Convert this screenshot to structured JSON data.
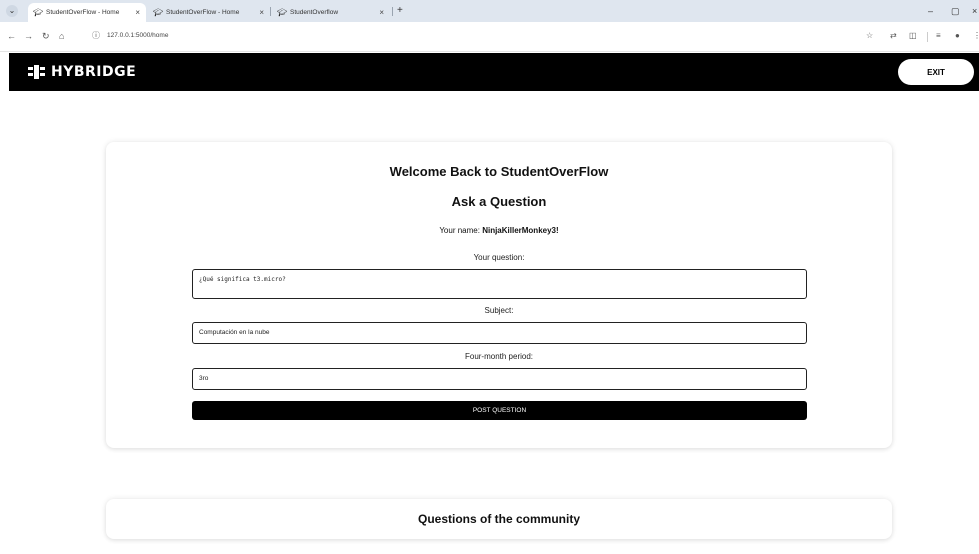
{
  "browser": {
    "tabs": [
      {
        "title": "StudentOverFlow - Home",
        "active": true
      },
      {
        "title": "StudentOverFlow - Home",
        "active": false
      },
      {
        "title": "StudentOverflow",
        "active": false
      }
    ],
    "new_tab": "+",
    "url": "127.0.0.1:5000/home",
    "tab_close": "×",
    "window_controls": {
      "minimize": "–",
      "maximize": "▢",
      "close": "×"
    }
  },
  "header": {
    "logo_text": "HYBRIDGE",
    "exit_label": "EXIT"
  },
  "form": {
    "welcome_title": "Welcome Back to StudentOverFlow",
    "ask_title": "Ask a Question",
    "your_name_label": "Your name:",
    "your_name_value": "NinjaKillerMonkey3!",
    "question_label": "Your question:",
    "question_value": "¿Qué significa t3.micro?",
    "subject_label": "Subject:",
    "subject_value": "Computación en la nube",
    "period_label": "Four-month period:",
    "period_value": "3ro",
    "submit_label": "POST QUESTION"
  },
  "community": {
    "title": "Questions of the community"
  }
}
